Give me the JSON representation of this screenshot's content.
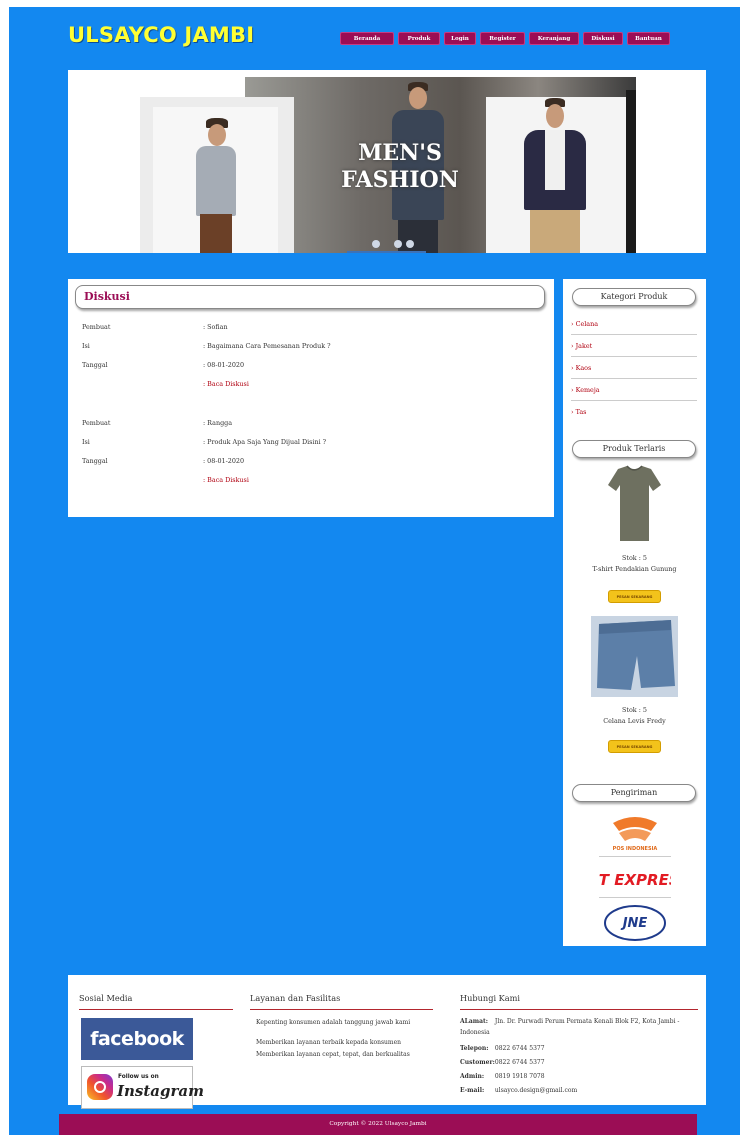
{
  "site": {
    "title": "ULSAYCO JAMBI"
  },
  "nav": {
    "items": [
      {
        "label": "Beranda"
      },
      {
        "label": "Produk"
      },
      {
        "label": "Login"
      },
      {
        "label": "Register"
      },
      {
        "label": "Keranjang"
      },
      {
        "label": "Diskusi"
      },
      {
        "label": "Bantuan"
      }
    ]
  },
  "banner": {
    "headline_line1": "MEN'S",
    "headline_line2": "FASHION",
    "slide_count": 3
  },
  "main": {
    "heading": "Diskusi",
    "discussions": [
      {
        "creator_label": "Pembuat",
        "creator": ": Sofian",
        "content_label": "Isi",
        "content": ": Bagaimana Cara Pemesanan Produk ?",
        "date_label": "Tanggal",
        "date": ": 08-01-2020",
        "read_link": ": Baca Diskusi"
      },
      {
        "creator_label": "Pembuat",
        "creator": ": Rangga",
        "content_label": "Isi",
        "content": ": Produk Apa Saja Yang Dijual Disini ?",
        "date_label": "Tanggal",
        "date": ": 08-01-2020",
        "read_link": ": Baca Diskusi"
      }
    ]
  },
  "sidebar": {
    "categories_heading": "Kategori Produk",
    "categories": [
      "› Celana",
      "› Jaket",
      "› Kaos",
      "› Kemeja",
      "› Tas"
    ],
    "bestsellers_heading": "Produk Terlaris",
    "bestsellers": [
      {
        "stock": "Stok : 5",
        "name": "T-shirt Pendakian Gunung",
        "button": "PESAN SEKARANG"
      },
      {
        "stock": "Stok : 5",
        "name": "Celana Levis Fredy",
        "button": "PESAN SEKARANG"
      }
    ],
    "shipping_heading": "Pengiriman",
    "shipping": [
      {
        "name": "POS INDONESIA"
      },
      {
        "name": "J&T EXPRESS"
      },
      {
        "name": "JNE"
      }
    ]
  },
  "footer": {
    "social_heading": "Sosial Media",
    "facebook_text": "facebook",
    "instagram_follow": "Follow us on",
    "instagram_text": "Instagram",
    "services_heading": "Layanan dan Fasilitas",
    "services": [
      "Kepenting konsumen adalah tanggung jawab kami",
      "Memberikan layanan terbaik kepada konsumen",
      "Memberikan layanan cepat, tepat, dan berkualitas"
    ],
    "contact_heading": "Hubungi Kami",
    "contact": {
      "address_label": "ALamat:",
      "address": "Jln. Dr. Purwadi Perum Permata Kenali Blok F2, Kota Jambi - Indonesia",
      "phone_label": "Telepon:",
      "phone": "0822 6744 5377",
      "customer_label": "Customer:",
      "customer": "0822 6744 5377",
      "admin_label": "Admin:",
      "admin": "0819 1918 7078",
      "email_label": "E-mail:",
      "email": "ulsayco.design@gmail.com"
    },
    "copyright": "Copyright © 2022 Ulsayco Jambi"
  },
  "colors": {
    "page_bg": "#1388f0",
    "title_yellow": "#ffff33",
    "nav_maroon": "#9b0d55",
    "link_red": "#b00010"
  }
}
